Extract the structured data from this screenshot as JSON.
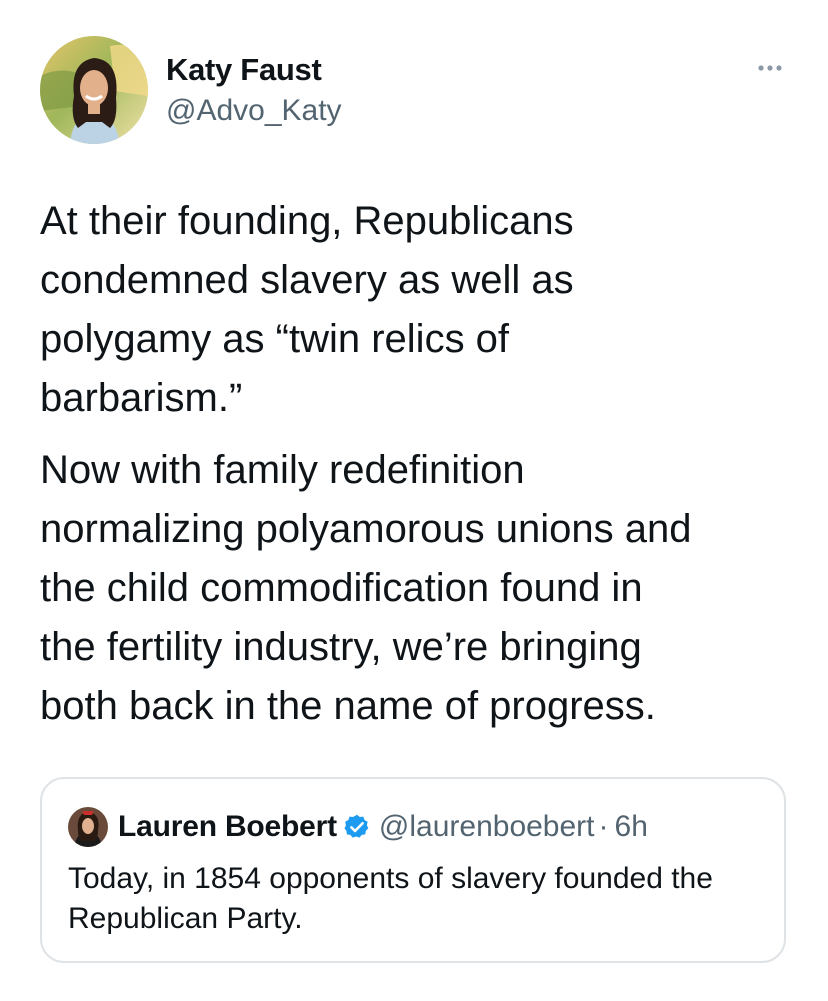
{
  "tweet": {
    "author": {
      "name": "Katy Faust",
      "handle": "@Advo_Katy"
    },
    "paragraphs": [
      "At their founding, Republicans\ncondemned slavery as well as\npolygamy as “twin relics of\nbarbarism.”",
      "Now with family redefinition\nnormalizing polyamorous unions and\nthe child commodification found in\nthe fertility industry, we’re bringing\nboth back in the name of progress."
    ],
    "more_icon": "more-horizontal-icon"
  },
  "quoted_tweet": {
    "author": {
      "name": "Lauren Boebert",
      "handle": "@laurenboebert",
      "verified": true
    },
    "separator": "·",
    "time": "6h",
    "text": "Today, in 1854 opponents of slavery founded the Republican Party."
  },
  "colors": {
    "text_primary": "#0f1419",
    "text_secondary": "#536471",
    "verified_blue": "#1d9bf0",
    "card_border": "#dfe3e6"
  }
}
